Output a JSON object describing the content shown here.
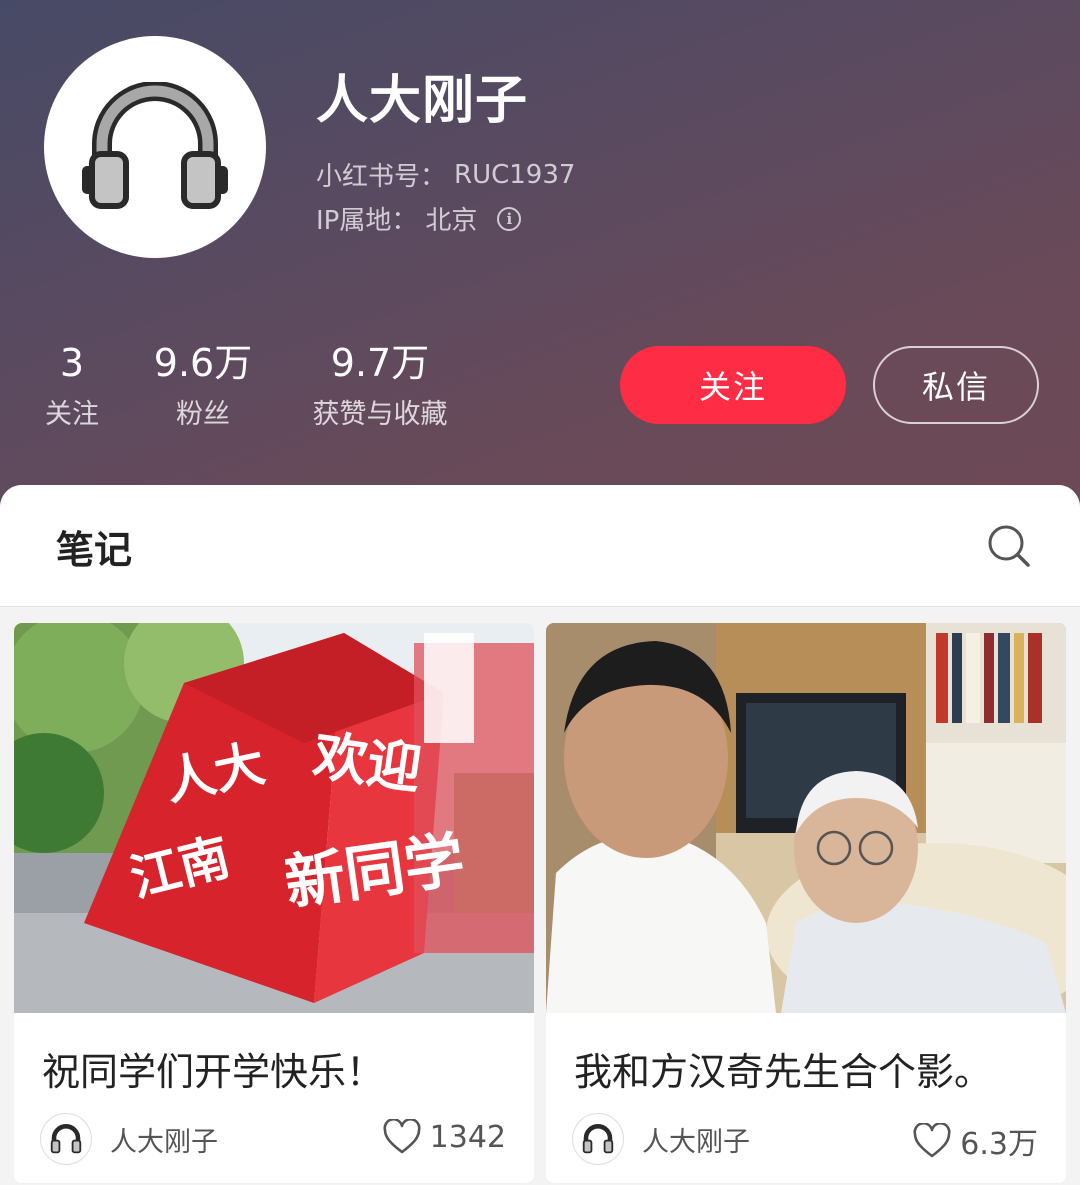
{
  "profile": {
    "name": "人大刚子",
    "id_label": "小红书号：",
    "id_value": "RUC1937",
    "ip_label": "IP属地：",
    "ip_value": "北京",
    "avatar_icon": "headphones-icon"
  },
  "stats": [
    {
      "value": "3",
      "label": "关注"
    },
    {
      "value": "9.6万",
      "label": "粉丝"
    },
    {
      "value": "9.7万",
      "label": "获赞与收藏"
    }
  ],
  "actions": {
    "follow_label": "关注",
    "message_label": "私信"
  },
  "tabs": {
    "notes_label": "笔记"
  },
  "colors": {
    "accent": "#fe2c44",
    "header_start": "#474a66",
    "header_end": "#6e4855"
  },
  "notes": [
    {
      "title": "祝同学们开学快乐！",
      "author": "人大刚子",
      "likes": "1342",
      "photo_text": [
        "人大",
        "江南",
        "欢迎",
        "新同学"
      ]
    },
    {
      "title": "我和方汉奇先生合个影。",
      "author": "人大刚子",
      "likes": "6.3万"
    }
  ]
}
